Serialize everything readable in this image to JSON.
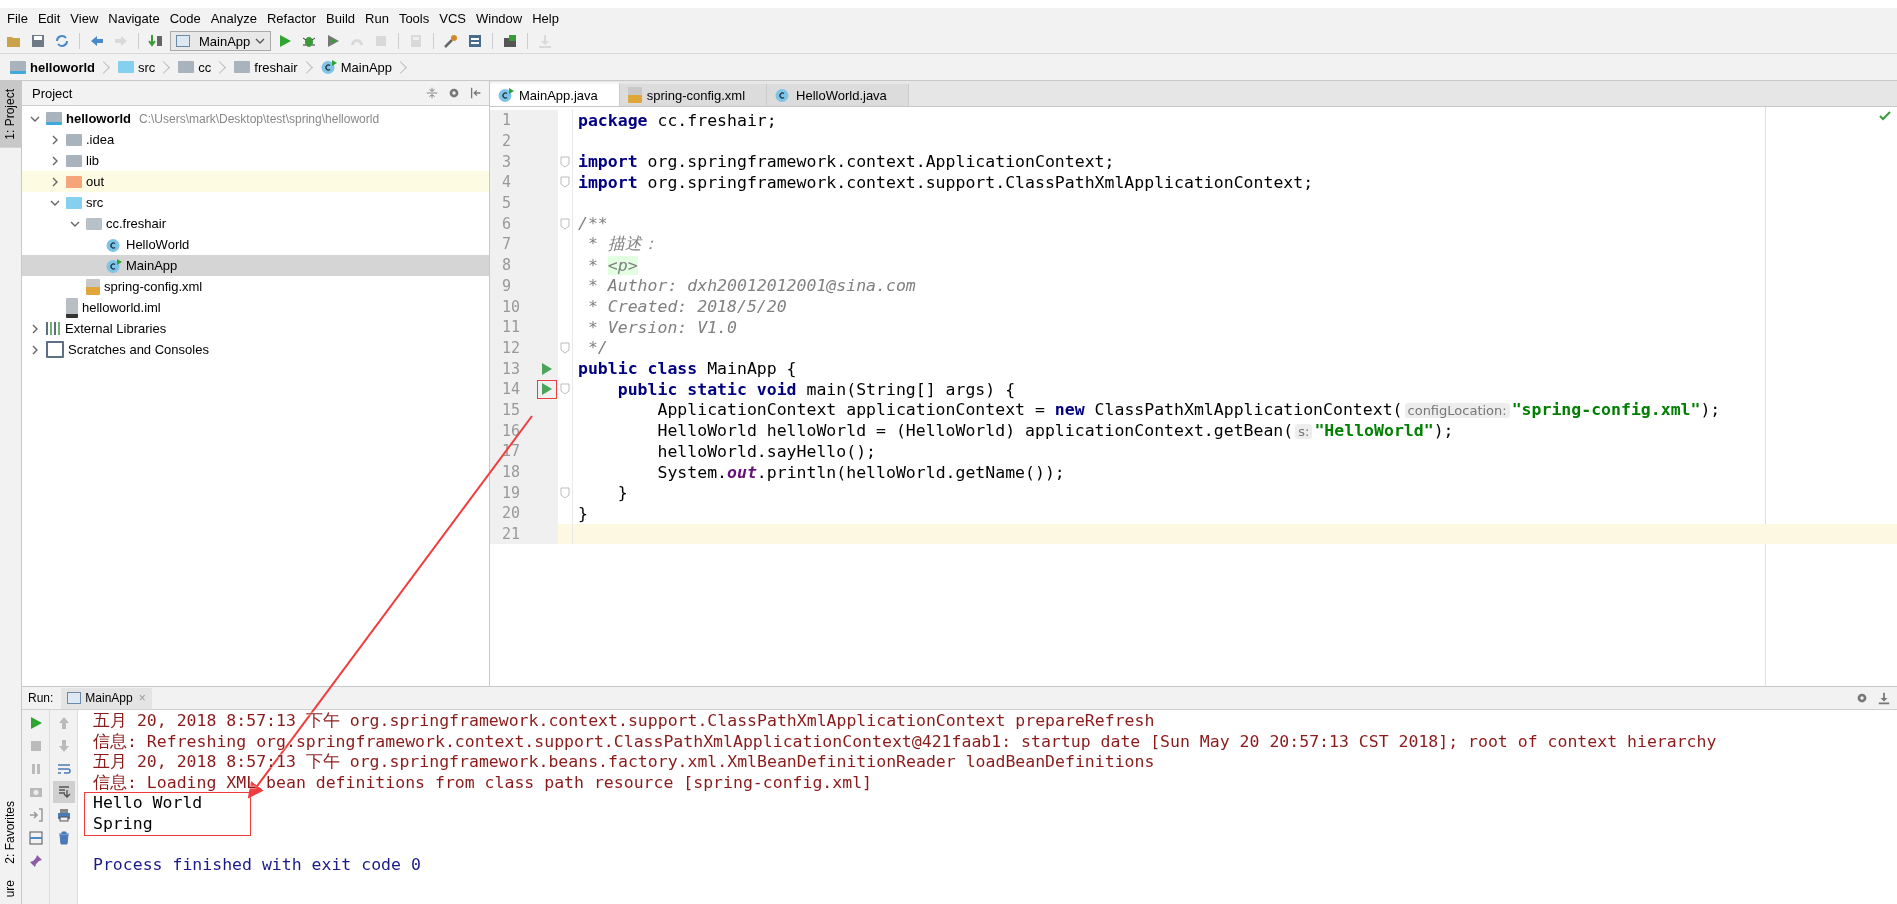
{
  "menu": [
    "File",
    "Edit",
    "View",
    "Navigate",
    "Code",
    "Analyze",
    "Refactor",
    "Build",
    "Run",
    "Tools",
    "VCS",
    "Window",
    "Help"
  ],
  "toolbar": [
    {
      "kind": "open",
      "disabled": false
    },
    {
      "kind": "save",
      "disabled": false
    },
    {
      "kind": "sync",
      "disabled": false
    },
    {
      "kind": "sep"
    },
    {
      "kind": "back",
      "disabled": false
    },
    {
      "kind": "forward",
      "disabled": true
    },
    {
      "kind": "sep"
    },
    {
      "kind": "build",
      "disabled": false
    },
    {
      "kind": "run-config",
      "label": "MainApp"
    },
    {
      "kind": "run",
      "disabled": false
    },
    {
      "kind": "debug",
      "disabled": false
    },
    {
      "kind": "coverage",
      "disabled": false
    },
    {
      "kind": "profile",
      "disabled": true
    },
    {
      "kind": "stop",
      "disabled": true
    },
    {
      "kind": "sep"
    },
    {
      "kind": "structure",
      "disabled": true
    },
    {
      "kind": "sep"
    },
    {
      "kind": "settings",
      "disabled": false
    },
    {
      "kind": "project-structure",
      "disabled": false
    },
    {
      "kind": "sep"
    },
    {
      "kind": "sdk",
      "disabled": false
    },
    {
      "kind": "sep"
    },
    {
      "kind": "download",
      "disabled": true
    }
  ],
  "breadcrumb": [
    {
      "label": "helloworld",
      "kind": "module"
    },
    {
      "label": "src",
      "kind": "folder-source"
    },
    {
      "label": "cc",
      "kind": "folder"
    },
    {
      "label": "freshair",
      "kind": "folder"
    },
    {
      "label": "MainApp",
      "kind": "class-main"
    }
  ],
  "side_tabs": {
    "top": [
      "1: Project"
    ],
    "bottom": [
      "2: Favorites",
      "ure"
    ]
  },
  "project": {
    "title": "Project",
    "tree": [
      {
        "label": "helloworld",
        "kind": "module",
        "path": "C:\\Users\\mark\\Desktop\\test\\spring\\helloworld",
        "expanded": true,
        "selected": false,
        "highlighted": false,
        "children": [
          {
            "label": ".idea",
            "kind": "folder",
            "expanded": false,
            "selected": false,
            "highlighted": false
          },
          {
            "label": "lib",
            "kind": "folder",
            "expanded": false,
            "selected": false,
            "highlighted": false
          },
          {
            "label": "out",
            "kind": "folder-excluded",
            "expanded": false,
            "selected": false,
            "highlighted": true
          },
          {
            "label": "src",
            "kind": "folder-source",
            "expanded": true,
            "selected": false,
            "highlighted": false,
            "children": [
              {
                "label": "cc.freshair",
                "kind": "package",
                "expanded": true,
                "selected": false,
                "highlighted": false,
                "children": [
                  {
                    "label": "HelloWorld",
                    "kind": "class",
                    "selected": false,
                    "highlighted": false
                  },
                  {
                    "label": "MainApp",
                    "kind": "class-main",
                    "selected": true,
                    "highlighted": false
                  }
                ]
              },
              {
                "label": "spring-config.xml",
                "kind": "xml",
                "selected": false,
                "highlighted": false
              }
            ]
          },
          {
            "label": "helloworld.iml",
            "kind": "iml",
            "selected": false,
            "highlighted": false
          }
        ]
      },
      {
        "label": "External Libraries",
        "kind": "libraries",
        "expanded": false,
        "selected": false,
        "highlighted": false
      },
      {
        "label": "Scratches and Consoles",
        "kind": "scratches",
        "expanded": false,
        "selected": false,
        "highlighted": false
      }
    ]
  },
  "editor": {
    "tabs": [
      {
        "label": "MainApp.java",
        "kind": "class-main",
        "selected": true
      },
      {
        "label": "spring-config.xml",
        "kind": "xml",
        "selected": false
      },
      {
        "label": "HelloWorld.java",
        "kind": "class",
        "selected": false
      }
    ],
    "lines": [
      {
        "number": "1",
        "run": false,
        "marked": false,
        "fold": false,
        "current": false,
        "segments": [
          {
            "kind": "kw",
            "text": "package"
          },
          {
            "kind": "plain",
            "text": " cc.freshair;"
          }
        ]
      },
      {
        "number": "2",
        "run": false,
        "marked": false,
        "fold": false,
        "current": false
      },
      {
        "number": "3",
        "run": false,
        "marked": false,
        "fold": true,
        "current": false,
        "segments": [
          {
            "kind": "kw",
            "text": "import"
          },
          {
            "kind": "plain",
            "text": " org.springframework.context.ApplicationContext;"
          }
        ]
      },
      {
        "number": "4",
        "run": false,
        "marked": false,
        "fold": true,
        "current": false,
        "segments": [
          {
            "kind": "kw",
            "text": "import"
          },
          {
            "kind": "plain",
            "text": " org.springframework.context.support.ClassPathXmlApplicationContext;"
          }
        ]
      },
      {
        "number": "5",
        "run": false,
        "marked": false,
        "fold": false,
        "current": false
      },
      {
        "number": "6",
        "run": false,
        "marked": false,
        "fold": true,
        "current": false,
        "segments": [
          {
            "kind": "comment",
            "text": "/**"
          }
        ]
      },
      {
        "number": "7",
        "run": false,
        "marked": false,
        "fold": false,
        "current": false,
        "segments": [
          {
            "kind": "comment",
            "text": " * 描述："
          }
        ]
      },
      {
        "number": "8",
        "run": false,
        "marked": false,
        "fold": false,
        "current": false,
        "segments": [
          {
            "kind": "comment",
            "text": " * "
          },
          {
            "kind": "tag",
            "text": "<p>"
          }
        ]
      },
      {
        "number": "9",
        "run": false,
        "marked": false,
        "fold": false,
        "current": false,
        "segments": [
          {
            "kind": "comment",
            "text": " * Author: dxh20012012001@sina.com"
          }
        ]
      },
      {
        "number": "10",
        "run": false,
        "marked": false,
        "fold": false,
        "current": false,
        "segments": [
          {
            "kind": "comment",
            "text": " * Created: 2018/5/20"
          }
        ]
      },
      {
        "number": "11",
        "run": false,
        "marked": false,
        "fold": false,
        "current": false,
        "segments": [
          {
            "kind": "comment",
            "text": " * Version: V1.0"
          }
        ]
      },
      {
        "number": "12",
        "run": false,
        "marked": false,
        "fold": true,
        "current": false,
        "segments": [
          {
            "kind": "comment",
            "text": " */"
          }
        ]
      },
      {
        "number": "13",
        "run": true,
        "marked": false,
        "fold": false,
        "current": false,
        "segments": [
          {
            "kind": "kw",
            "text": "public class"
          },
          {
            "kind": "plain",
            "text": " MainApp {"
          }
        ]
      },
      {
        "number": "14",
        "run": true,
        "marked": true,
        "fold": true,
        "current": false,
        "segments": [
          {
            "kind": "kw",
            "text": "    public static void"
          },
          {
            "kind": "plain",
            "text": " main(String[] args) {"
          }
        ]
      },
      {
        "number": "15",
        "run": false,
        "marked": false,
        "fold": false,
        "current": false,
        "segments": [
          {
            "kind": "plain",
            "text": "        ApplicationContext applicationContext = "
          },
          {
            "kind": "kw",
            "text": "new"
          },
          {
            "kind": "plain",
            "text": " ClassPathXmlApplicationContext("
          },
          {
            "kind": "hint",
            "text": "configLocation:"
          },
          {
            "kind": "str",
            "text": "\"spring-config.xml\""
          },
          {
            "kind": "plain",
            "text": ");"
          }
        ]
      },
      {
        "number": "16",
        "run": false,
        "marked": false,
        "fold": false,
        "current": false,
        "segments": [
          {
            "kind": "plain",
            "text": "        HelloWorld helloWorld = (HelloWorld) applicationContext.getBean("
          },
          {
            "kind": "hint",
            "text": "s:"
          },
          {
            "kind": "str",
            "text": "\"HelloWorld\""
          },
          {
            "kind": "plain",
            "text": ");"
          }
        ]
      },
      {
        "number": "17",
        "run": false,
        "marked": false,
        "fold": false,
        "current": false,
        "segments": [
          {
            "kind": "plain",
            "text": "        helloWorld.sayHello();"
          }
        ]
      },
      {
        "number": "18",
        "run": false,
        "marked": false,
        "fold": false,
        "current": false,
        "segments": [
          {
            "kind": "plain",
            "text": "        System."
          },
          {
            "kind": "field",
            "text": "out"
          },
          {
            "kind": "plain",
            "text": ".println(helloWorld.getName());"
          }
        ]
      },
      {
        "number": "19",
        "run": false,
        "marked": false,
        "fold": true,
        "current": false,
        "segments": [
          {
            "kind": "plain",
            "text": "    }"
          }
        ]
      },
      {
        "number": "20",
        "run": false,
        "marked": false,
        "fold": false,
        "current": false,
        "segments": [
          {
            "kind": "plain",
            "text": "}"
          }
        ]
      },
      {
        "number": "21",
        "run": false,
        "marked": false,
        "fold": false,
        "current": true
      }
    ]
  },
  "run_panel": {
    "label": "Run:",
    "tab": "MainApp",
    "close": "×",
    "console": [
      {
        "kind": "log",
        "boxed": false,
        "text": "五月 20, 2018 8:57:13 下午 org.springframework.context.support.ClassPathXmlApplicationContext prepareRefresh"
      },
      {
        "kind": "log",
        "boxed": false,
        "text": "信息: Refreshing org.springframework.context.support.ClassPathXmlApplicationContext@421faab1: startup date [Sun May 20 20:57:13 CST 2018]; root of context hierarchy"
      },
      {
        "kind": "log",
        "boxed": false,
        "text": "五月 20, 2018 8:57:13 下午 org.springframework.beans.factory.xml.XmlBeanDefinitionReader loadBeanDefinitions"
      },
      {
        "kind": "log",
        "boxed": false,
        "text": "信息: Loading XML bean definitions from class path resource [spring-config.xml]"
      },
      {
        "kind": "output",
        "boxed": true,
        "text": "Hello World"
      },
      {
        "kind": "output",
        "boxed": true,
        "text": "Spring"
      },
      {
        "kind": "blank",
        "boxed": false
      },
      {
        "kind": "process",
        "boxed": false,
        "text": "Process finished with exit code 0"
      }
    ]
  }
}
